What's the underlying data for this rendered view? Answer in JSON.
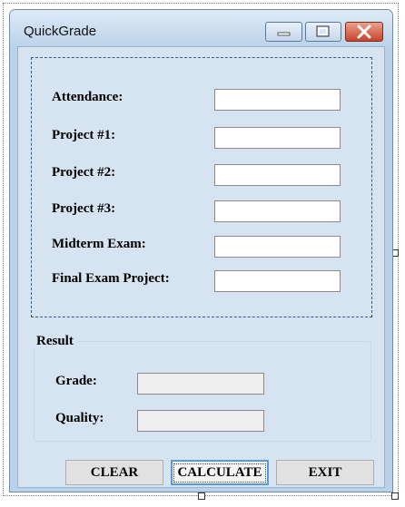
{
  "window": {
    "title": "QuickGrade"
  },
  "inputs": [
    {
      "label": "Attendance:",
      "value": ""
    },
    {
      "label": "Project #1:",
      "value": ""
    },
    {
      "label": "Project #2:",
      "value": ""
    },
    {
      "label": "Project #3:",
      "value": ""
    },
    {
      "label": "Midterm Exam:",
      "value": ""
    },
    {
      "label": "Final Exam Project:",
      "value": ""
    }
  ],
  "result": {
    "title": "Result",
    "grade_label": "Grade:",
    "grade_value": "",
    "quality_label": "Quality:",
    "quality_value": ""
  },
  "buttons": {
    "clear": "CLEAR",
    "calculate": "CALCULATE",
    "exit": "EXIT"
  },
  "colors": {
    "close_button": "#c8452b",
    "client_bg": "#d6e3f1",
    "frame": "#b9d1ea"
  }
}
